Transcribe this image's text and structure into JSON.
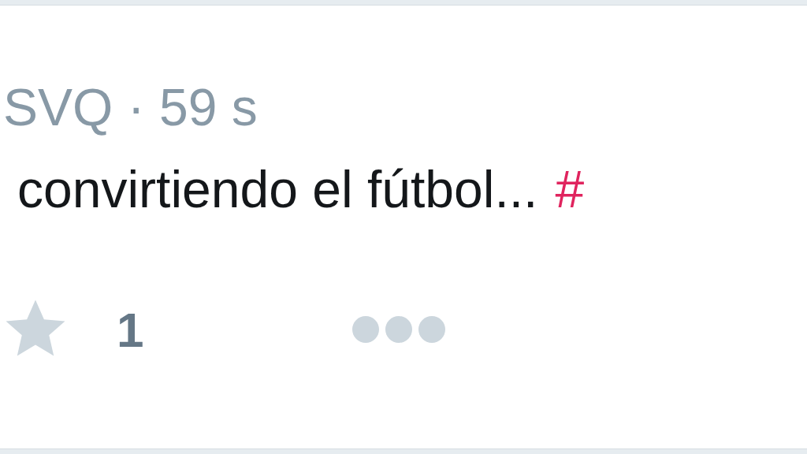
{
  "tweet": {
    "meta": "SVQ · 59 s",
    "text": "convirtiendo el fútbol...",
    "hashtag": "#",
    "actions": [
      {
        "kind": "favorite",
        "count": "1"
      },
      {
        "kind": "more"
      }
    ]
  }
}
